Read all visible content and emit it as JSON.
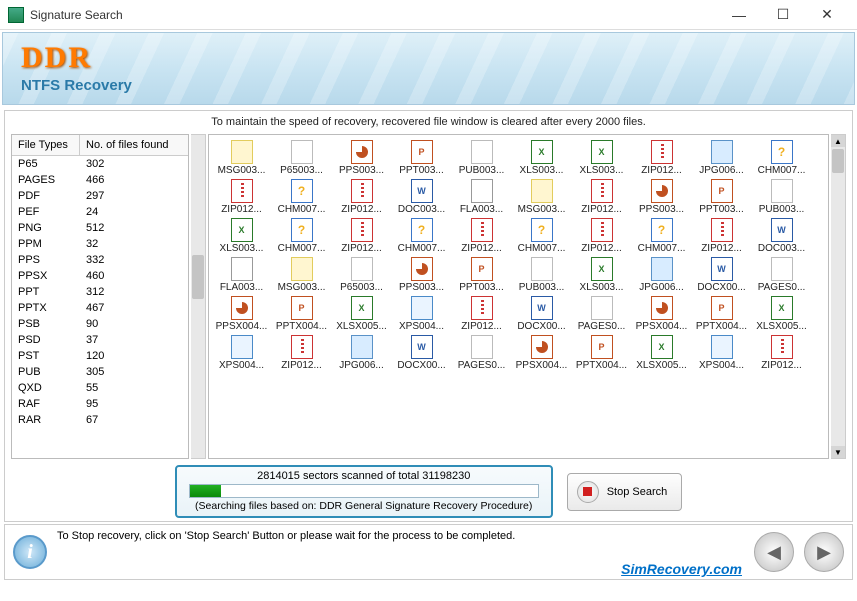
{
  "titlebar": {
    "title": "Signature Search"
  },
  "banner": {
    "ddr": "DDR",
    "subtitle": "NTFS Recovery"
  },
  "info_msg": "To maintain the speed of recovery, recovered file window is cleared after every 2000 files.",
  "filetypes": {
    "head_type": "File Types",
    "head_count": "No. of files found",
    "rows": [
      {
        "t": "P65",
        "c": "302"
      },
      {
        "t": "PAGES",
        "c": "466"
      },
      {
        "t": "PDF",
        "c": "297"
      },
      {
        "t": "PEF",
        "c": "24"
      },
      {
        "t": "PNG",
        "c": "512"
      },
      {
        "t": "PPM",
        "c": "32"
      },
      {
        "t": "PPS",
        "c": "332"
      },
      {
        "t": "PPSX",
        "c": "460"
      },
      {
        "t": "PPT",
        "c": "312"
      },
      {
        "t": "PPTX",
        "c": "467"
      },
      {
        "t": "PSB",
        "c": "90"
      },
      {
        "t": "PSD",
        "c": "37"
      },
      {
        "t": "PST",
        "c": "120"
      },
      {
        "t": "PUB",
        "c": "305"
      },
      {
        "t": "QXD",
        "c": "55"
      },
      {
        "t": "RAF",
        "c": "95"
      },
      {
        "t": "RAR",
        "c": "67"
      }
    ]
  },
  "files": [
    [
      {
        "n": "MSG003...",
        "i": "msg"
      },
      {
        "n": "P65003...",
        "i": "page"
      },
      {
        "n": "PPS003...",
        "i": "pps"
      },
      {
        "n": "PPT003...",
        "i": "ppt"
      },
      {
        "n": "PUB003...",
        "i": "page"
      },
      {
        "n": "XLS003...",
        "i": "xls"
      },
      {
        "n": "XLS003...",
        "i": "xls"
      },
      {
        "n": "ZIP012...",
        "i": "zip"
      },
      {
        "n": "JPG006...",
        "i": "jpg"
      },
      {
        "n": "CHM007...",
        "i": "chm"
      }
    ],
    [
      {
        "n": "ZIP012...",
        "i": "zip"
      },
      {
        "n": "CHM007...",
        "i": "chm"
      },
      {
        "n": "ZIP012...",
        "i": "zip"
      },
      {
        "n": "DOC003...",
        "i": "doc"
      },
      {
        "n": "FLA003...",
        "i": "fla"
      },
      {
        "n": "MSG003...",
        "i": "msg"
      },
      {
        "n": "ZIP012...",
        "i": "zip"
      },
      {
        "n": "PPS003...",
        "i": "pps"
      },
      {
        "n": "PPT003...",
        "i": "ppt"
      },
      {
        "n": "PUB003...",
        "i": "page"
      }
    ],
    [
      {
        "n": "XLS003...",
        "i": "xls"
      },
      {
        "n": "CHM007...",
        "i": "chm"
      },
      {
        "n": "ZIP012...",
        "i": "zip"
      },
      {
        "n": "CHM007...",
        "i": "chm"
      },
      {
        "n": "ZIP012...",
        "i": "zip"
      },
      {
        "n": "CHM007...",
        "i": "chm"
      },
      {
        "n": "ZIP012...",
        "i": "zip"
      },
      {
        "n": "CHM007...",
        "i": "chm"
      },
      {
        "n": "ZIP012...",
        "i": "zip"
      },
      {
        "n": "DOC003...",
        "i": "doc"
      }
    ],
    [
      {
        "n": "FLA003...",
        "i": "fla"
      },
      {
        "n": "MSG003...",
        "i": "msg"
      },
      {
        "n": "P65003...",
        "i": "page"
      },
      {
        "n": "PPS003...",
        "i": "pps"
      },
      {
        "n": "PPT003...",
        "i": "ppt"
      },
      {
        "n": "PUB003...",
        "i": "page"
      },
      {
        "n": "XLS003...",
        "i": "xls"
      },
      {
        "n": "JPG006...",
        "i": "jpg"
      },
      {
        "n": "DOCX00...",
        "i": "doc"
      },
      {
        "n": "PAGES0...",
        "i": "page"
      }
    ],
    [
      {
        "n": "PPSX004...",
        "i": "pps"
      },
      {
        "n": "PPTX004...",
        "i": "ppt"
      },
      {
        "n": "XLSX005...",
        "i": "xls"
      },
      {
        "n": "XPS004...",
        "i": "xps"
      },
      {
        "n": "ZIP012...",
        "i": "zip"
      },
      {
        "n": "DOCX00...",
        "i": "doc"
      },
      {
        "n": "PAGES0...",
        "i": "page"
      },
      {
        "n": "PPSX004...",
        "i": "pps"
      },
      {
        "n": "PPTX004...",
        "i": "ppt"
      },
      {
        "n": "XLSX005...",
        "i": "xls"
      }
    ],
    [
      {
        "n": "XPS004...",
        "i": "xps"
      },
      {
        "n": "ZIP012...",
        "i": "zip"
      },
      {
        "n": "JPG006...",
        "i": "jpg"
      },
      {
        "n": "DOCX00...",
        "i": "doc"
      },
      {
        "n": "PAGES0...",
        "i": "page"
      },
      {
        "n": "PPSX004...",
        "i": "pps"
      },
      {
        "n": "PPTX004...",
        "i": "ppt"
      },
      {
        "n": "XLSX005...",
        "i": "xls"
      },
      {
        "n": "XPS004...",
        "i": "xps"
      },
      {
        "n": "ZIP012...",
        "i": "zip"
      }
    ]
  ],
  "progress": {
    "text": "2814015 sectors scanned of total 31198230",
    "subtext": "(Searching files based on:  DDR General Signature Recovery Procedure)"
  },
  "stop_label": "Stop Search",
  "footer_text": "To Stop recovery, click on 'Stop Search' Button or please wait for the process to be completed.",
  "watermark": "SimRecovery.com"
}
